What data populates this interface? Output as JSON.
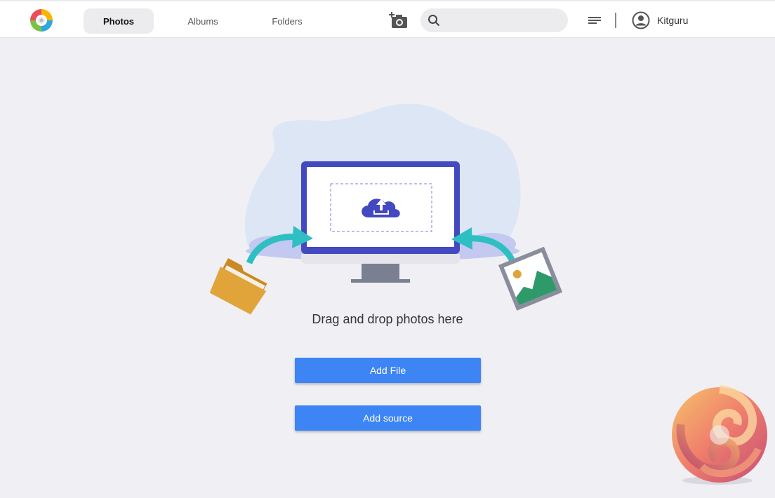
{
  "header": {
    "tabs": [
      {
        "label": "Photos",
        "active": true
      },
      {
        "label": "Albums",
        "active": false
      },
      {
        "label": "Folders",
        "active": false
      }
    ],
    "search": {
      "value": "",
      "placeholder": ""
    },
    "user": {
      "name": "Kitguru"
    }
  },
  "main": {
    "drop_text": "Drag and drop photos here",
    "add_file_label": "Add File",
    "add_source_label": "Add source"
  },
  "colors": {
    "accent": "#3d84f5",
    "monitor": "#4349c0",
    "arrow": "#2ebfc2",
    "folder": "#e0a43a",
    "background": "#f0f0f4"
  },
  "icons": [
    "app-logo-icon",
    "add-photo-camera-icon",
    "search-icon",
    "list-view-icon",
    "user-avatar-icon",
    "cloud-upload-icon",
    "folder-icon",
    "image-icon",
    "watermark-logo"
  ]
}
